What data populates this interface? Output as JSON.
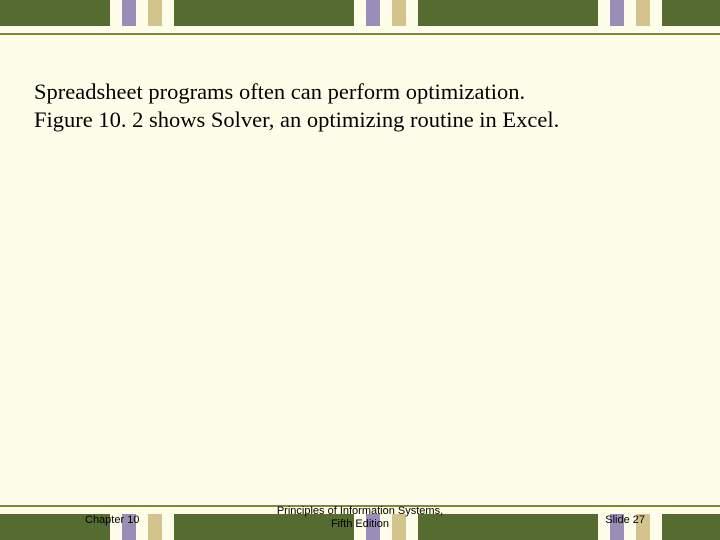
{
  "content": {
    "line1": "Spreadsheet programs often can perform optimization.",
    "line2": "Figure 10. 2 shows Solver, an optimizing routine in Excel."
  },
  "footer": {
    "chapter": "Chapter 10",
    "book_line1": "Principles of Information Systems,",
    "book_line2": "Fifth Edition",
    "slide": "Slide 27"
  }
}
